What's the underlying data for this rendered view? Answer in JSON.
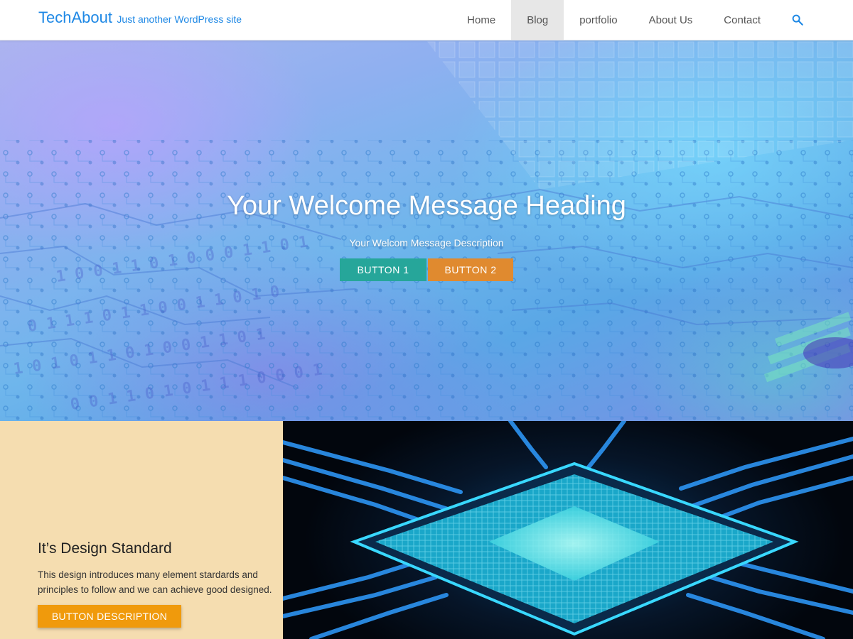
{
  "site": {
    "title": "TechAbout",
    "tagline": "Just another WordPress site"
  },
  "nav": {
    "items": [
      "Home",
      "Blog",
      "portfolio",
      "About Us",
      "Contact"
    ],
    "active": "Blog",
    "search_icon": "search-icon"
  },
  "hero": {
    "heading": "Your Welcome Message Heading",
    "description": "Your Welcom Message Description",
    "button1": "BUTTON 1",
    "button2": "BUTTON 2"
  },
  "feature": {
    "title": "It’s Design Standard",
    "text": "This design introduces many element stardards and principles to follow and we can achieve good designed.",
    "button": "BUTTON DESCRIPTION"
  },
  "colors": {
    "brand": "#1e88e5",
    "button1": "#26a69a",
    "button2": "#e08a2f",
    "feature_bg": "#f5ddb0",
    "feature_button": "#f09a0c"
  }
}
